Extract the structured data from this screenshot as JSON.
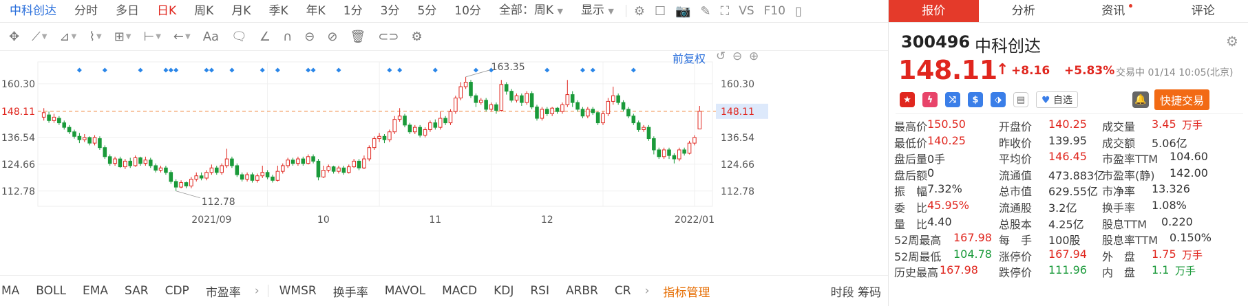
{
  "topbar": {
    "stock_name": "中科创达",
    "periods": [
      "分时",
      "多日",
      "日K",
      "周K",
      "月K",
      "季K",
      "年K",
      "1分",
      "3分",
      "5分",
      "10分"
    ],
    "active_period": "日K",
    "range_select": "全部：周K",
    "display_label": "显示",
    "vs_label": "VS",
    "f10_label": "F10"
  },
  "toolbar": {
    "text_tool": "Aa",
    "adjust_label": "前复权"
  },
  "chart_data": {
    "type": "candlestick",
    "y_ticks": [
      "160.30",
      "148.11",
      "136.54",
      "124.66",
      "112.78"
    ],
    "y_tick_values": [
      160.3,
      148.11,
      136.54,
      124.66,
      112.78
    ],
    "ylim": [
      106.0,
      170.0
    ],
    "x_labels": [
      "2021/09",
      "10",
      "11",
      "12",
      "2022/01"
    ],
    "last_price_line": 148.11,
    "annotations": [
      {
        "label": "163.35",
        "value": 163.35
      },
      {
        "label": "112.78",
        "value": 112.78
      }
    ],
    "candles": [
      {
        "o": 145.5,
        "c": 147.5,
        "h": 149.5,
        "l": 144.0
      },
      {
        "o": 146.5,
        "c": 144.0,
        "h": 148.0,
        "l": 143.0
      },
      {
        "o": 144.0,
        "c": 145.5,
        "h": 147.0,
        "l": 143.0
      },
      {
        "o": 145.0,
        "c": 143.0,
        "h": 146.0,
        "l": 142.0
      },
      {
        "o": 143.0,
        "c": 141.0,
        "h": 144.0,
        "l": 140.0
      },
      {
        "o": 141.0,
        "c": 139.0,
        "h": 142.0,
        "l": 138.0
      },
      {
        "o": 139.0,
        "c": 137.0,
        "h": 140.0,
        "l": 136.0
      },
      {
        "o": 137.0,
        "c": 135.5,
        "h": 138.5,
        "l": 134.0
      },
      {
        "o": 135.5,
        "c": 136.5,
        "h": 138.0,
        "l": 134.5
      },
      {
        "o": 136.5,
        "c": 134.0,
        "h": 137.0,
        "l": 133.0
      },
      {
        "o": 134.0,
        "c": 136.5,
        "h": 137.5,
        "l": 133.0
      },
      {
        "o": 136.0,
        "c": 132.0,
        "h": 137.0,
        "l": 131.0
      },
      {
        "o": 132.0,
        "c": 128.0,
        "h": 133.0,
        "l": 127.0
      },
      {
        "o": 128.0,
        "c": 125.0,
        "h": 129.0,
        "l": 124.0
      },
      {
        "o": 125.0,
        "c": 127.0,
        "h": 128.0,
        "l": 124.0
      },
      {
        "o": 127.0,
        "c": 123.5,
        "h": 128.0,
        "l": 123.0
      },
      {
        "o": 123.5,
        "c": 126.0,
        "h": 127.0,
        "l": 122.5
      },
      {
        "o": 126.0,
        "c": 124.0,
        "h": 127.5,
        "l": 123.0
      },
      {
        "o": 124.0,
        "c": 127.5,
        "h": 128.5,
        "l": 123.5
      },
      {
        "o": 127.5,
        "c": 125.0,
        "h": 128.0,
        "l": 124.0
      },
      {
        "o": 125.0,
        "c": 126.5,
        "h": 128.0,
        "l": 124.0
      },
      {
        "o": 126.5,
        "c": 124.0,
        "h": 127.5,
        "l": 123.0
      },
      {
        "o": 124.0,
        "c": 122.0,
        "h": 125.0,
        "l": 121.0
      },
      {
        "o": 122.0,
        "c": 123.0,
        "h": 124.0,
        "l": 121.0
      },
      {
        "o": 123.0,
        "c": 121.0,
        "h": 124.0,
        "l": 120.0
      },
      {
        "o": 121.0,
        "c": 117.0,
        "h": 122.0,
        "l": 116.0
      },
      {
        "o": 117.0,
        "c": 114.5,
        "h": 118.0,
        "l": 112.78
      },
      {
        "o": 114.5,
        "c": 116.5,
        "h": 117.5,
        "l": 114.0
      },
      {
        "o": 116.5,
        "c": 115.0,
        "h": 117.0,
        "l": 114.0
      },
      {
        "o": 115.0,
        "c": 118.0,
        "h": 119.0,
        "l": 114.0
      },
      {
        "o": 118.0,
        "c": 119.5,
        "h": 121.0,
        "l": 117.0
      },
      {
        "o": 119.5,
        "c": 118.5,
        "h": 121.0,
        "l": 117.5
      },
      {
        "o": 118.5,
        "c": 121.0,
        "h": 122.0,
        "l": 117.5
      },
      {
        "o": 121.0,
        "c": 123.0,
        "h": 124.5,
        "l": 120.0
      },
      {
        "o": 123.0,
        "c": 121.0,
        "h": 124.0,
        "l": 120.0
      },
      {
        "o": 121.0,
        "c": 124.0,
        "h": 125.0,
        "l": 120.0
      },
      {
        "o": 124.0,
        "c": 127.0,
        "h": 131.5,
        "l": 123.0
      },
      {
        "o": 127.0,
        "c": 124.0,
        "h": 128.0,
        "l": 123.0
      },
      {
        "o": 124.0,
        "c": 120.0,
        "h": 125.0,
        "l": 119.0
      },
      {
        "o": 120.0,
        "c": 118.0,
        "h": 121.0,
        "l": 117.0
      },
      {
        "o": 118.0,
        "c": 120.0,
        "h": 121.0,
        "l": 117.0
      },
      {
        "o": 120.0,
        "c": 117.5,
        "h": 121.0,
        "l": 116.5
      },
      {
        "o": 117.5,
        "c": 119.5,
        "h": 120.5,
        "l": 116.5
      },
      {
        "o": 119.5,
        "c": 121.0,
        "h": 124.0,
        "l": 118.5
      },
      {
        "o": 121.0,
        "c": 119.0,
        "h": 122.0,
        "l": 118.0
      },
      {
        "o": 119.0,
        "c": 117.5,
        "h": 120.0,
        "l": 116.5
      },
      {
        "o": 117.5,
        "c": 121.5,
        "h": 124.0,
        "l": 117.0
      },
      {
        "o": 121.5,
        "c": 124.0,
        "h": 125.0,
        "l": 120.5
      },
      {
        "o": 124.0,
        "c": 126.5,
        "h": 127.5,
        "l": 123.0
      },
      {
        "o": 126.5,
        "c": 125.0,
        "h": 127.5,
        "l": 124.0
      },
      {
        "o": 125.0,
        "c": 127.0,
        "h": 128.0,
        "l": 124.0
      },
      {
        "o": 127.0,
        "c": 125.0,
        "h": 128.0,
        "l": 124.0
      },
      {
        "o": 125.0,
        "c": 128.0,
        "h": 129.0,
        "l": 124.5
      },
      {
        "o": 128.0,
        "c": 126.0,
        "h": 129.0,
        "l": 125.0
      },
      {
        "o": 126.0,
        "c": 119.0,
        "h": 127.0,
        "l": 117.5
      },
      {
        "o": 119.0,
        "c": 122.0,
        "h": 124.0,
        "l": 118.5
      },
      {
        "o": 122.0,
        "c": 123.5,
        "h": 124.5,
        "l": 121.0
      },
      {
        "o": 123.5,
        "c": 121.5,
        "h": 124.0,
        "l": 120.5
      },
      {
        "o": 121.5,
        "c": 123.0,
        "h": 124.0,
        "l": 120.5
      },
      {
        "o": 123.0,
        "c": 121.0,
        "h": 124.0,
        "l": 120.0
      },
      {
        "o": 121.0,
        "c": 123.5,
        "h": 124.5,
        "l": 120.5
      },
      {
        "o": 123.5,
        "c": 126.0,
        "h": 127.0,
        "l": 123.0
      },
      {
        "o": 126.0,
        "c": 123.0,
        "h": 127.0,
        "l": 122.0
      },
      {
        "o": 123.0,
        "c": 127.0,
        "h": 128.5,
        "l": 122.5
      },
      {
        "o": 127.0,
        "c": 132.0,
        "h": 133.0,
        "l": 126.0
      },
      {
        "o": 132.0,
        "c": 136.0,
        "h": 137.0,
        "l": 131.0
      },
      {
        "o": 136.0,
        "c": 137.0,
        "h": 138.5,
        "l": 134.5
      },
      {
        "o": 137.0,
        "c": 135.5,
        "h": 138.0,
        "l": 134.0
      },
      {
        "o": 135.5,
        "c": 139.0,
        "h": 140.0,
        "l": 134.5
      },
      {
        "o": 139.0,
        "c": 144.5,
        "h": 146.0,
        "l": 138.0
      },
      {
        "o": 144.5,
        "c": 146.0,
        "h": 149.5,
        "l": 143.5
      },
      {
        "o": 146.0,
        "c": 142.0,
        "h": 147.0,
        "l": 141.0
      },
      {
        "o": 142.0,
        "c": 139.0,
        "h": 143.0,
        "l": 138.0
      },
      {
        "o": 139.0,
        "c": 141.0,
        "h": 142.0,
        "l": 138.0
      },
      {
        "o": 141.0,
        "c": 137.5,
        "h": 142.0,
        "l": 136.5
      },
      {
        "o": 137.5,
        "c": 140.0,
        "h": 141.0,
        "l": 136.5
      },
      {
        "o": 140.0,
        "c": 143.0,
        "h": 144.0,
        "l": 139.0
      },
      {
        "o": 143.0,
        "c": 141.0,
        "h": 144.5,
        "l": 140.0
      },
      {
        "o": 141.0,
        "c": 145.0,
        "h": 148.0,
        "l": 140.0
      },
      {
        "o": 145.0,
        "c": 143.0,
        "h": 146.0,
        "l": 142.0
      },
      {
        "o": 143.0,
        "c": 148.0,
        "h": 149.0,
        "l": 142.0
      },
      {
        "o": 148.0,
        "c": 154.0,
        "h": 155.0,
        "l": 147.0
      },
      {
        "o": 154.0,
        "c": 159.0,
        "h": 161.0,
        "l": 153.0
      },
      {
        "o": 159.0,
        "c": 161.0,
        "h": 163.35,
        "l": 158.0
      },
      {
        "o": 161.0,
        "c": 155.0,
        "h": 162.0,
        "l": 154.0
      },
      {
        "o": 155.0,
        "c": 152.0,
        "h": 156.0,
        "l": 150.0
      },
      {
        "o": 152.0,
        "c": 153.0,
        "h": 154.0,
        "l": 151.0
      },
      {
        "o": 153.0,
        "c": 149.0,
        "h": 154.0,
        "l": 148.0
      },
      {
        "o": 149.0,
        "c": 151.0,
        "h": 152.0,
        "l": 148.0
      },
      {
        "o": 151.0,
        "c": 148.5,
        "h": 152.0,
        "l": 147.0
      },
      {
        "o": 148.5,
        "c": 160.0,
        "h": 162.0,
        "l": 148.0
      },
      {
        "o": 160.0,
        "c": 157.0,
        "h": 161.0,
        "l": 155.5
      },
      {
        "o": 157.0,
        "c": 153.0,
        "h": 158.0,
        "l": 152.0
      },
      {
        "o": 153.0,
        "c": 155.0,
        "h": 156.0,
        "l": 152.0
      },
      {
        "o": 155.0,
        "c": 152.0,
        "h": 156.0,
        "l": 150.5
      },
      {
        "o": 152.0,
        "c": 156.0,
        "h": 157.0,
        "l": 151.0
      },
      {
        "o": 156.0,
        "c": 150.0,
        "h": 157.0,
        "l": 149.0
      },
      {
        "o": 150.0,
        "c": 145.0,
        "h": 151.0,
        "l": 144.0
      },
      {
        "o": 145.0,
        "c": 149.0,
        "h": 150.0,
        "l": 144.0
      },
      {
        "o": 149.0,
        "c": 147.0,
        "h": 150.0,
        "l": 146.0
      },
      {
        "o": 147.0,
        "c": 149.5,
        "h": 150.0,
        "l": 146.0
      },
      {
        "o": 149.5,
        "c": 148.0,
        "h": 150.0,
        "l": 147.0
      },
      {
        "o": 148.0,
        "c": 151.0,
        "h": 152.0,
        "l": 147.0
      },
      {
        "o": 151.0,
        "c": 155.5,
        "h": 162.0,
        "l": 150.0
      },
      {
        "o": 155.5,
        "c": 152.0,
        "h": 157.0,
        "l": 150.0
      },
      {
        "o": 152.0,
        "c": 149.0,
        "h": 153.0,
        "l": 148.0
      },
      {
        "o": 149.0,
        "c": 146.0,
        "h": 150.0,
        "l": 145.0
      },
      {
        "o": 146.0,
        "c": 149.0,
        "h": 150.0,
        "l": 145.0
      },
      {
        "o": 149.0,
        "c": 147.5,
        "h": 150.0,
        "l": 146.5
      },
      {
        "o": 147.5,
        "c": 143.0,
        "h": 148.0,
        "l": 142.0
      },
      {
        "o": 143.0,
        "c": 147.0,
        "h": 148.0,
        "l": 142.0
      },
      {
        "o": 147.0,
        "c": 152.5,
        "h": 154.0,
        "l": 146.0
      },
      {
        "o": 152.5,
        "c": 155.0,
        "h": 159.0,
        "l": 151.0
      },
      {
        "o": 155.0,
        "c": 152.0,
        "h": 156.0,
        "l": 151.0
      },
      {
        "o": 152.0,
        "c": 149.0,
        "h": 153.0,
        "l": 148.0
      },
      {
        "o": 149.0,
        "c": 146.0,
        "h": 150.0,
        "l": 145.0
      },
      {
        "o": 146.0,
        "c": 143.0,
        "h": 147.0,
        "l": 142.0
      },
      {
        "o": 143.0,
        "c": 140.0,
        "h": 144.0,
        "l": 139.0
      },
      {
        "o": 140.0,
        "c": 141.0,
        "h": 142.0,
        "l": 139.0
      },
      {
        "o": 141.0,
        "c": 136.0,
        "h": 142.0,
        "l": 135.0
      },
      {
        "o": 136.0,
        "c": 131.0,
        "h": 137.0,
        "l": 129.0
      },
      {
        "o": 131.0,
        "c": 128.0,
        "h": 132.0,
        "l": 127.0
      },
      {
        "o": 128.0,
        "c": 131.0,
        "h": 132.0,
        "l": 127.0
      },
      {
        "o": 131.0,
        "c": 128.5,
        "h": 132.0,
        "l": 127.0
      },
      {
        "o": 128.5,
        "c": 127.0,
        "h": 129.5,
        "l": 125.0
      },
      {
        "o": 127.0,
        "c": 131.0,
        "h": 132.0,
        "l": 126.0
      },
      {
        "o": 131.0,
        "c": 129.5,
        "h": 132.0,
        "l": 128.5
      },
      {
        "o": 129.5,
        "c": 134.0,
        "h": 135.0,
        "l": 129.0
      },
      {
        "o": 134.0,
        "c": 136.5,
        "h": 137.5,
        "l": 133.0
      },
      {
        "o": 140.25,
        "c": 148.11,
        "h": 150.5,
        "l": 140.25
      }
    ],
    "markers": [
      7,
      12,
      19,
      24,
      25,
      26,
      32,
      33,
      37,
      43,
      46,
      52,
      53,
      58,
      68,
      70,
      77,
      85,
      88,
      99,
      106,
      108,
      116
    ]
  },
  "bottombar": {
    "indicators": [
      "MA",
      "BOLL",
      "EMA",
      "SAR",
      "CDP",
      "市盈率"
    ],
    "indicators2": [
      "WMSR",
      "换手率",
      "MAVOL",
      "MACD",
      "KDJ",
      "RSI",
      "ARBR",
      "CR"
    ],
    "manage_label": "指标管理",
    "right_label": "时段 筹码"
  },
  "panel": {
    "tabs": [
      "报价",
      "分析",
      "资讯",
      "评论"
    ],
    "code": "300496",
    "name": "中科创达",
    "price": "148.11",
    "change": "+8.16",
    "change_pct": "+5.83%",
    "status": "交易中 01/14 10:05(北京)",
    "fav_label": "自选",
    "trade_label": "快捷交易",
    "colors": {
      "up": "#e0261e",
      "down": "#1a9a3a",
      "accent": "#e43a2a",
      "orange": "#f26a14"
    },
    "rows": [
      [
        {
          "l": "最高价",
          "v": "150.50",
          "c": "red"
        },
        {
          "l": "开盘价",
          "v": "140.25",
          "c": "red"
        },
        {
          "l": "成交量",
          "v": "3.45",
          "u": "万手",
          "c": "red"
        }
      ],
      [
        {
          "l": "最低价",
          "v": "140.25",
          "c": "red"
        },
        {
          "l": "昨收价",
          "v": "139.95",
          "c": "blk"
        },
        {
          "l": "成交额",
          "v": "5.06亿",
          "c": "blk"
        }
      ],
      [
        {
          "l": "盘后量",
          "v": "0手",
          "c": "blk"
        },
        {
          "l": "平均价",
          "v": "146.45",
          "c": "red"
        },
        {
          "l": "市盈率TTM",
          "v": "104.60",
          "c": "blk"
        }
      ],
      [
        {
          "l": "盘后额",
          "v": "0",
          "c": "blk"
        },
        {
          "l": "流通值",
          "v": "473.883亿",
          "c": "blk"
        },
        {
          "l": "市盈率(静)",
          "v": "142.00",
          "c": "blk"
        }
      ],
      [
        {
          "l": "振　幅",
          "v": "7.32%",
          "c": "blk"
        },
        {
          "l": "总市值",
          "v": "629.55亿",
          "c": "blk"
        },
        {
          "l": "市净率",
          "v": "13.326",
          "c": "blk"
        }
      ],
      [
        {
          "l": "委　比",
          "v": "45.95%",
          "c": "red"
        },
        {
          "l": "流通股",
          "v": "3.2亿",
          "c": "blk"
        },
        {
          "l": "换手率",
          "v": "1.08%",
          "c": "blk"
        }
      ],
      [
        {
          "l": "量　比",
          "v": "4.40",
          "c": "blk"
        },
        {
          "l": "总股本",
          "v": "4.25亿",
          "c": "blk"
        },
        {
          "l": "股息TTM",
          "v": "0.220",
          "c": "blk"
        }
      ],
      [
        {
          "l": "52周最高",
          "v": "167.98",
          "c": "red"
        },
        {
          "l": "每　手",
          "v": "100股",
          "c": "blk"
        },
        {
          "l": "股息率TTM",
          "v": "0.150%",
          "c": "blk"
        }
      ],
      [
        {
          "l": "52周最低",
          "v": "104.78",
          "c": "grn"
        },
        {
          "l": "涨停价",
          "v": "167.94",
          "c": "red"
        },
        {
          "l": "外　盘",
          "v": "1.75",
          "u": "万手",
          "c": "red"
        }
      ],
      [
        {
          "l": "历史最高",
          "v": "167.98",
          "c": "red"
        },
        {
          "l": "跌停价",
          "v": "111.96",
          "c": "grn"
        },
        {
          "l": "内　盘",
          "v": "1.1",
          "u": "万手",
          "c": "grn"
        }
      ]
    ]
  }
}
